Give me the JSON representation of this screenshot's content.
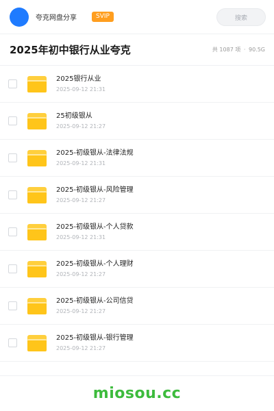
{
  "header": {
    "share_name": "夸克网盘分享",
    "badge": "SVIP",
    "search_placeholder": "搜索"
  },
  "title_bar": {
    "title": "2025年初中银行从业夸克",
    "count_text": "共 1087 项",
    "separator": "·",
    "size_text": "90.5G"
  },
  "files": [
    {
      "name": "2025银行从业",
      "date": "2025-09-12 21:31"
    },
    {
      "name": "25初级银从",
      "date": "2025-09-12 21:27"
    },
    {
      "name": "2025-初级银从-法律法规",
      "date": "2025-09-12 21:31"
    },
    {
      "name": "2025-初级银从-风险管理",
      "date": "2025-09-12 21:27"
    },
    {
      "name": "2025-初级银从-个人贷款",
      "date": "2025-09-12 21:31"
    },
    {
      "name": "2025-初级银从-个人理财",
      "date": "2025-09-12 21:27"
    },
    {
      "name": "2025-初级银从-公司信贷",
      "date": "2025-09-12 21:27"
    },
    {
      "name": "2025-初级银从-银行管理",
      "date": "2025-09-12 21:27"
    }
  ],
  "footer": {
    "watermark": "miosou.cc"
  },
  "colors": {
    "avatar": "#1f7bff",
    "badge": "#ff9e1f",
    "folder": "#ffc51a",
    "watermark": "#3dbb3d"
  }
}
